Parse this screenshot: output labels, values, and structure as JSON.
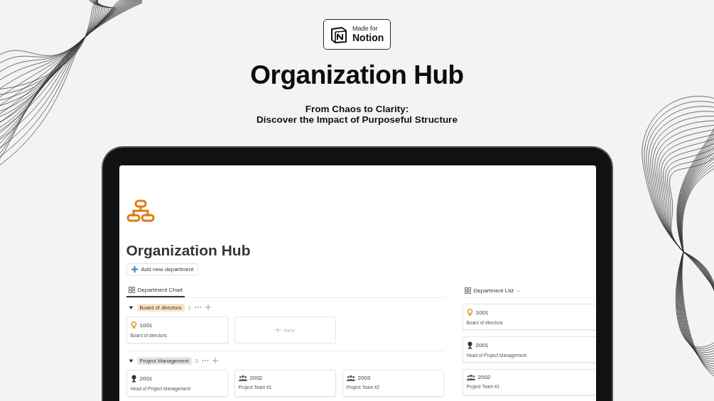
{
  "badge": {
    "line_1": "Made for",
    "line_2": "Notion"
  },
  "title": "Organization Hub",
  "subtitle_lines": [
    "From Chaos to Clarity:",
    "Discover the Impact of Purposeful Structure"
  ],
  "page": {
    "title": "Organization Hub",
    "add_button": "Add new department",
    "tabs": [
      {
        "label": "Department Chart",
        "selected": true
      }
    ],
    "groups": [
      {
        "name": "Board of directors",
        "color": "#fbe4c4",
        "count": "1",
        "cards": [
          {
            "kind": "award",
            "id": "1001",
            "name": "Board of directors"
          }
        ],
        "new_card": "New"
      },
      {
        "name": "Project Management",
        "color": "#e6e6e4",
        "count": "3",
        "cards": [
          {
            "kind": "head",
            "id": "2001",
            "name": "Head of Project Management"
          },
          {
            "kind": "team",
            "id": "2002",
            "name": "Project Team #1"
          },
          {
            "kind": "team",
            "id": "2003",
            "name": "Project Team #2"
          }
        ]
      }
    ],
    "list_view": {
      "label": "Department List",
      "cards": [
        {
          "kind": "award",
          "id": "1001",
          "name": "Board of directors"
        },
        {
          "kind": "head",
          "id": "2001",
          "name": "Head of Project Management"
        },
        {
          "kind": "team",
          "id": "2002",
          "name": "Project Team #1"
        }
      ]
    }
  }
}
